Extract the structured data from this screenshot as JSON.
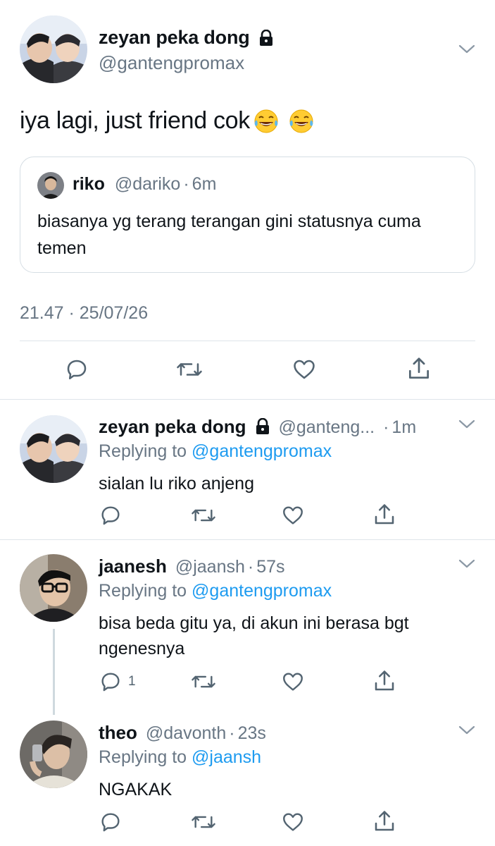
{
  "main_tweet": {
    "display_name": "zeyan peka dong",
    "handle": "@gantengpromax",
    "text": "iya lagi, just friend cok",
    "emojis": [
      "face-with-tears-of-joy",
      "face-with-tears-of-joy"
    ],
    "timestamp": "21.47 · 25/07/26",
    "quote": {
      "display_name": "riko",
      "handle": "@dariko",
      "time": "6m",
      "text": "biasanya yg terang terangan gini statusnya cuma temen"
    }
  },
  "replies": [
    {
      "display_name": "zeyan peka dong",
      "handle": "@ganteng...",
      "time": "1m",
      "replying_prefix": "Replying to",
      "replying_to": "@gantengpromax",
      "text": "sialan lu riko anjeng",
      "reply_count": ""
    },
    {
      "display_name": "jaanesh",
      "handle": "@jaansh",
      "time": "57s",
      "replying_prefix": "Replying to",
      "replying_to": "@gantengpromax",
      "text": "bisa beda gitu ya, di akun ini berasa bgt ngenesnya",
      "reply_count": "1"
    },
    {
      "display_name": "theo",
      "handle": "@davonth",
      "time": "23s",
      "replying_prefix": "Replying to",
      "replying_to": "@jaansh",
      "text": "NGAKAK",
      "reply_count": ""
    }
  ],
  "labels": {
    "dot": "·"
  },
  "colors": {
    "link": "#1d9bf0",
    "muted": "#687684",
    "icon": "#536471",
    "divider": "#dfe5ea"
  }
}
